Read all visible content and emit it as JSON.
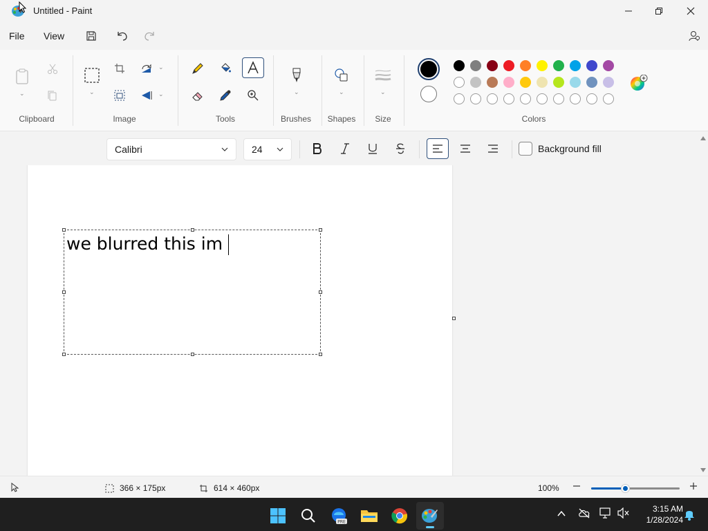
{
  "window": {
    "title": "Untitled - Paint"
  },
  "menu": {
    "file": "File",
    "view": "View"
  },
  "ribbon": {
    "groups": {
      "clipboard": "Clipboard",
      "image": "Image",
      "tools": "Tools",
      "brushes": "Brushes",
      "shapes": "Shapes",
      "size": "Size",
      "colors": "Colors"
    }
  },
  "palette": {
    "row1": [
      "#000000",
      "#7f7f7f",
      "#880015",
      "#ed1c24",
      "#ff7f27",
      "#fff200",
      "#22b14c",
      "#00a2e8",
      "#3f48cc",
      "#a349a4"
    ],
    "row2": [
      "#ffffff",
      "#c3c3c3",
      "#b97a57",
      "#ffaec9",
      "#ffc90e",
      "#efe4b0",
      "#b5e61d",
      "#99d9ea",
      "#7092be",
      "#c8bfe7"
    ],
    "row3_empty_count": 10,
    "color1": "#000000",
    "color2": "#ffffff"
  },
  "text_toolbar": {
    "font": "Calibri",
    "size": "24",
    "background_fill": "Background fill"
  },
  "canvas": {
    "typed_text": "we blurred this im"
  },
  "status": {
    "selection_size": "366 × 175px",
    "canvas_size": "614 × 460px",
    "zoom": "100%",
    "zoom_fraction": 0.38
  },
  "taskbar": {
    "time": "3:15 AM",
    "date": "1/28/2024"
  }
}
